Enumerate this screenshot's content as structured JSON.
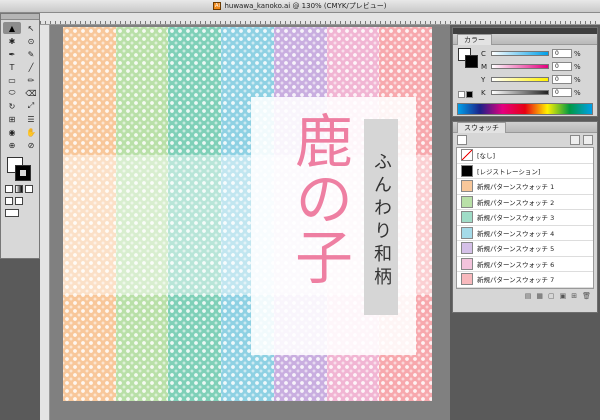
{
  "document": {
    "title": "huwawa_kanoko.ai @ 130% (CMYK/プレビュー)"
  },
  "artwork": {
    "main_text": "鹿の子",
    "sub_text": "ふんわり和柄",
    "main_color": "#ee7fa2",
    "stripes": [
      "#f8c79a",
      "#b9e0a8",
      "#7fd0b8",
      "#8ed1e3",
      "#c9aee0",
      "#f1b5d3",
      "#f7a8ad"
    ]
  },
  "tools": {
    "items": [
      "▲",
      "↖",
      "✱",
      "⊙",
      "✒",
      "✎",
      "T",
      "╱",
      "▭",
      "✏",
      "⬭",
      "⌫",
      "↻",
      "⤢",
      "⊞",
      "☰",
      "◉",
      "✋",
      "⊕",
      "⊘"
    ],
    "icons": [
      "selection-tool-icon",
      "direct-selection-tool-icon",
      "magic-wand-icon",
      "lasso-icon",
      "pen-tool-icon",
      "pencil-tool-icon",
      "type-tool-icon",
      "line-tool-icon",
      "rectangle-tool-icon",
      "paintbrush-icon",
      "blob-brush-icon",
      "eraser-icon",
      "rotate-tool-icon",
      "scale-tool-icon",
      "mesh-tool-icon",
      "graph-tool-icon",
      "eyedropper-icon",
      "hand-tool-icon",
      "zoom-tool-icon",
      "symbol-sprayer-icon"
    ]
  },
  "color_panel": {
    "title": "カラー",
    "channels": [
      {
        "label": "C",
        "value": "0",
        "unit": "%",
        "color": "#00a0e9"
      },
      {
        "label": "M",
        "value": "0",
        "unit": "%",
        "color": "#e4007f"
      },
      {
        "label": "Y",
        "value": "0",
        "unit": "%",
        "color": "#fff100"
      },
      {
        "label": "K",
        "value": "0",
        "unit": "%",
        "color": "#222222"
      }
    ]
  },
  "swatches_panel": {
    "title": "スウォッチ",
    "items": [
      {
        "label": "[なし]",
        "color": "none"
      },
      {
        "label": "[レジストレーション]",
        "color": "#000000"
      },
      {
        "label": "新規パターンスウォッチ 1",
        "color": "#f8c79a"
      },
      {
        "label": "新規パターンスウォッチ 2",
        "color": "#b9e0a8"
      },
      {
        "label": "新規パターンスウォッチ 3",
        "color": "#9fdcc7"
      },
      {
        "label": "新規パターンスウォッチ 4",
        "color": "#a5dbe9"
      },
      {
        "label": "新規パターンスウォッチ 5",
        "color": "#d5c0e8"
      },
      {
        "label": "新規パターンスウォッチ 6",
        "color": "#f3c3dc"
      },
      {
        "label": "新規パターンスウォッチ 7",
        "color": "#f8b9bd"
      }
    ],
    "footer_icons": [
      "library-menu-icon",
      "show-kinds-icon",
      "swatch-options-icon",
      "new-group-icon",
      "new-swatch-icon",
      "delete-swatch-icon"
    ]
  }
}
